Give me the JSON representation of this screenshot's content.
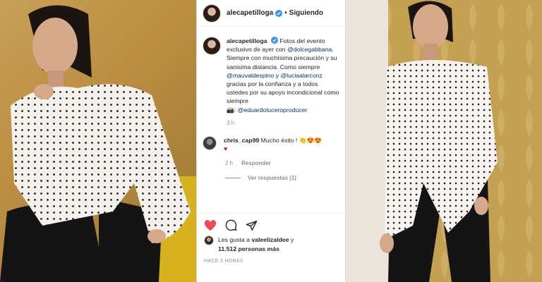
{
  "post": {
    "username": "alecapetilloga",
    "follow_status": "Siguiendo",
    "separator": "•"
  },
  "caption": {
    "username": "alecapetilloga",
    "line1": "Fotos del evento exclusivo de ayer con",
    "mention1": "@dolcegabbana",
    "line2": ". Siempre con muchísima precaución y su sanisima distancia. Como siempre",
    "mention2": "@mauvaldespino",
    "and_word": "y",
    "mention3": "@luciaalarconz",
    "line3": "gracias por la confianza y a todos ustedes por su apoyo incondicional como siempre",
    "camera_emoji": "📸:",
    "mention4": "@eduardoluceroproducer",
    "time": "3 h"
  },
  "comment": {
    "username": "chris_cap99",
    "text": "Mucho éxito ! 👏😍😍",
    "heart": "♥",
    "time": "2 h",
    "reply_label": "Responder",
    "view_replies": "Ver respuestas (1)"
  },
  "likes": {
    "prefix": "Les gusta a",
    "user": "valeelizaldee",
    "conj": "y",
    "count_text": "11.512 personas más"
  },
  "timestamp": "HACE 3 HORAS",
  "colors": {
    "like_red": "#ed4956",
    "verified_blue": "#3897f0",
    "mention_blue": "#00376b",
    "meta_gray": "#8e8e8e"
  },
  "icons": [
    "verified-badge-icon",
    "heart-icon",
    "comment-icon",
    "share-icon"
  ]
}
